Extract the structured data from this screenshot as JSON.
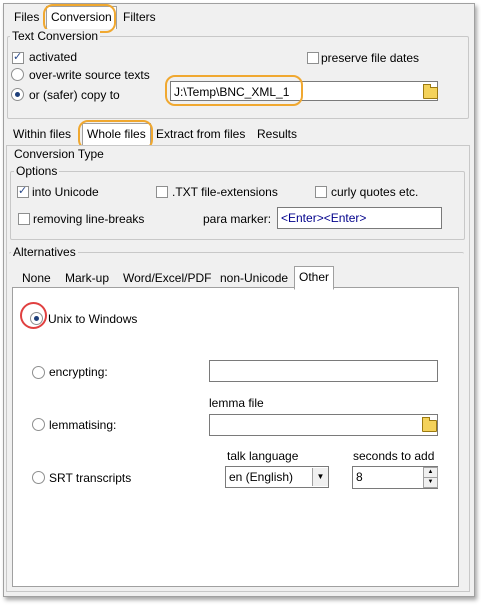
{
  "top_tabs": [
    "Files",
    "Conversion",
    "Filters"
  ],
  "text_conversion": {
    "title": "Text Conversion",
    "activated": "activated",
    "overwrite": "over-write source texts",
    "copy_to": "or (safer) copy to",
    "preserve_dates": "preserve file dates",
    "copy_path": "J:\\Temp\\BNC_XML_1"
  },
  "sub_tabs": [
    "Within files",
    "Whole files",
    "Extract from files",
    "Results"
  ],
  "conversion_type": {
    "title": "Conversion Type",
    "options_title": "Options",
    "into_unicode": "into Unicode",
    "txt_ext": ".TXT file-extensions",
    "curly": "curly quotes etc.",
    "removing_breaks": "removing line-breaks",
    "para_marker_label": "para marker:",
    "para_marker_value": "<Enter><Enter>"
  },
  "alternatives": {
    "title": "Alternatives",
    "tabs": [
      "None",
      "Mark-up",
      "Word/Excel/PDF",
      "non-Unicode",
      "Other"
    ],
    "unix_to_windows": "Unix to Windows",
    "encrypting": "encrypting:",
    "lemma_file": "lemma file",
    "lemmatising": "lemmatising:",
    "talk_language": "talk language",
    "seconds_to_add": "seconds to add",
    "srt": "SRT transcripts",
    "language_value": "en (English)",
    "seconds_value": "8"
  },
  "colors": {
    "highlight": "#f0a830",
    "red_circle": "#e04040",
    "para_marker_text": "#00008b"
  }
}
